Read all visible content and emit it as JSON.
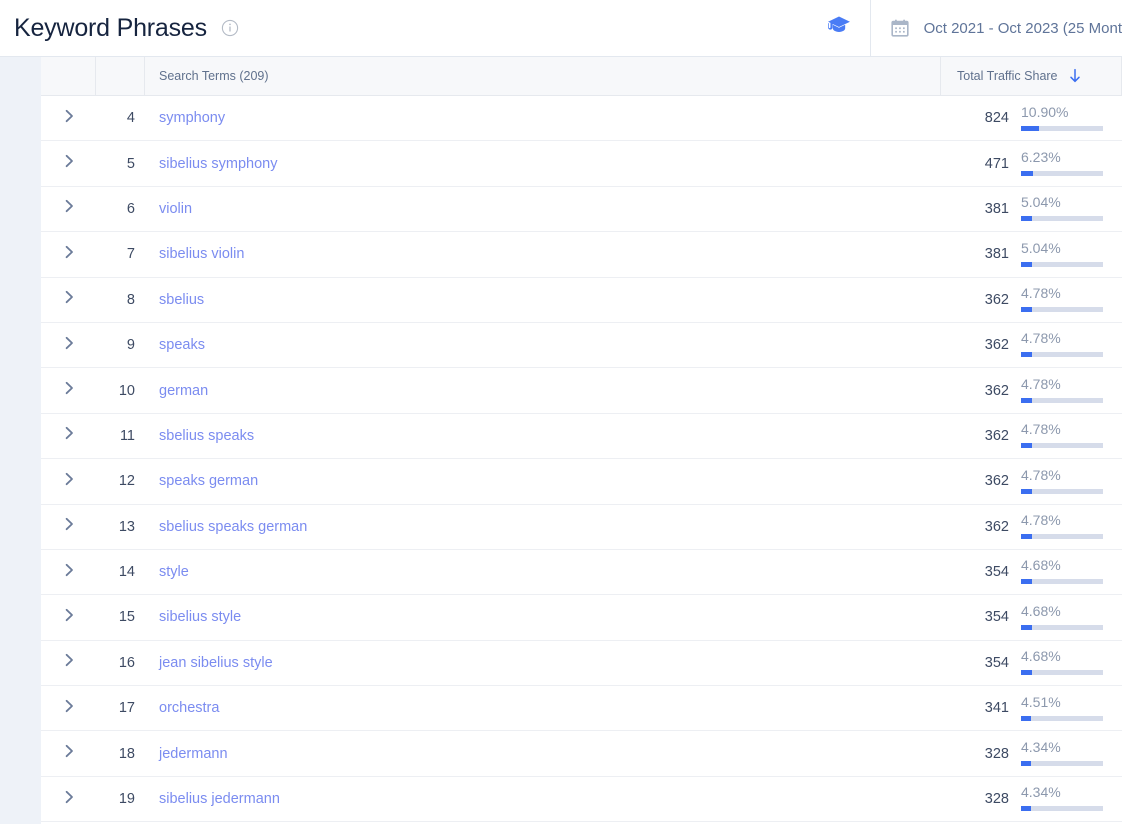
{
  "header": {
    "title": "Keyword Phrases",
    "info_icon": "info-circle-icon",
    "academy_icon": "graduation-cap-icon",
    "calendar_icon": "calendar-icon",
    "date_range": "Oct 2021 - Oct 2023 (25 Mont"
  },
  "table": {
    "columns": {
      "expand": "",
      "rank": "",
      "term": "Search Terms (209)",
      "share": "Total Traffic Share",
      "share_sort": "descending"
    },
    "rows": [
      {
        "rank": "4",
        "term": "symphony",
        "count": "824",
        "pct": "10.90%",
        "pct_value": 10.9
      },
      {
        "rank": "5",
        "term": "sibelius symphony",
        "count": "471",
        "pct": "6.23%",
        "pct_value": 6.23
      },
      {
        "rank": "6",
        "term": "violin",
        "count": "381",
        "pct": "5.04%",
        "pct_value": 5.04
      },
      {
        "rank": "7",
        "term": "sibelius violin",
        "count": "381",
        "pct": "5.04%",
        "pct_value": 5.04
      },
      {
        "rank": "8",
        "term": "sbelius",
        "count": "362",
        "pct": "4.78%",
        "pct_value": 4.78
      },
      {
        "rank": "9",
        "term": "speaks",
        "count": "362",
        "pct": "4.78%",
        "pct_value": 4.78
      },
      {
        "rank": "10",
        "term": "german",
        "count": "362",
        "pct": "4.78%",
        "pct_value": 4.78
      },
      {
        "rank": "11",
        "term": "sbelius speaks",
        "count": "362",
        "pct": "4.78%",
        "pct_value": 4.78
      },
      {
        "rank": "12",
        "term": "speaks german",
        "count": "362",
        "pct": "4.78%",
        "pct_value": 4.78
      },
      {
        "rank": "13",
        "term": "sbelius speaks german",
        "count": "362",
        "pct": "4.78%",
        "pct_value": 4.78
      },
      {
        "rank": "14",
        "term": "style",
        "count": "354",
        "pct": "4.68%",
        "pct_value": 4.68
      },
      {
        "rank": "15",
        "term": "sibelius style",
        "count": "354",
        "pct": "4.68%",
        "pct_value": 4.68
      },
      {
        "rank": "16",
        "term": "jean sibelius style",
        "count": "354",
        "pct": "4.68%",
        "pct_value": 4.68
      },
      {
        "rank": "17",
        "term": "orchestra",
        "count": "341",
        "pct": "4.51%",
        "pct_value": 4.51
      },
      {
        "rank": "18",
        "term": "jedermann",
        "count": "328",
        "pct": "4.34%",
        "pct_value": 4.34
      },
      {
        "rank": "19",
        "term": "sibelius jedermann",
        "count": "328",
        "pct": "4.34%",
        "pct_value": 4.34
      }
    ]
  },
  "colors": {
    "accent_blue": "#3b6ef0",
    "link_blue": "#7b8cf0",
    "bar_track": "#d6dcea",
    "title_navy": "#16243f",
    "page_bg": "#eef2f8"
  }
}
